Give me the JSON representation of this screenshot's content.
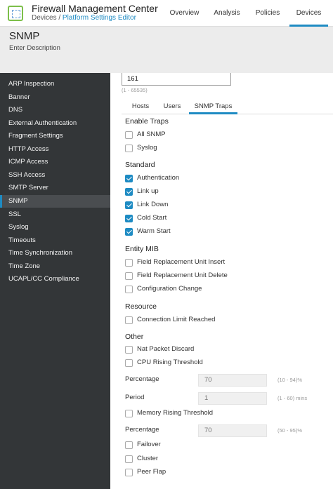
{
  "header": {
    "app_title": "Firewall Management Center",
    "breadcrumb_root": "Devices / ",
    "breadcrumb_link": "Platform Settings Editor",
    "nav": [
      "Overview",
      "Analysis",
      "Policies",
      "Devices"
    ],
    "active_nav": "Devices"
  },
  "page": {
    "title": "SNMP",
    "description": "Enter Description"
  },
  "sidebar": {
    "items": [
      "ARP Inspection",
      "Banner",
      "DNS",
      "External Authentication",
      "Fragment Settings",
      "HTTP Access",
      "ICMP Access",
      "SSH Access",
      "SMTP Server",
      "SNMP",
      "SSL",
      "Syslog",
      "Timeouts",
      "Time Synchronization",
      "Time Zone",
      "UCAPL/CC Compliance"
    ],
    "active": "SNMP"
  },
  "port": {
    "value": "161",
    "range_hint": "(1 - 65535)"
  },
  "tabs": {
    "items": [
      "Hosts",
      "Users",
      "SNMP Traps"
    ],
    "active": "SNMP Traps"
  },
  "traps": {
    "enable_traps": {
      "title": "Enable Traps",
      "all_snmp": "All SNMP",
      "syslog": "Syslog"
    },
    "standard": {
      "title": "Standard",
      "authentication": "Authentication",
      "link_up": "Link up",
      "link_down": "Link Down",
      "cold_start": "Cold Start",
      "warm_start": "Warm Start"
    },
    "entity_mib": {
      "title": "Entity MIB",
      "fru_insert": "Field Replacement Unit Insert",
      "fru_delete": "Field Replacement Unit Delete",
      "config_change": "Configuration Change"
    },
    "resource": {
      "title": "Resource",
      "conn_limit": "Connection Limit Reached"
    },
    "other": {
      "title": "Other",
      "nat_discard": "Nat Packet Discard",
      "cpu_rising": "CPU Rising Threshold",
      "cpu_percentage_label": "Percentage",
      "cpu_percentage_value": "70",
      "cpu_percentage_hint": "(10 - 94)%",
      "period_label": "Period",
      "period_value": "1",
      "period_hint": "(1 - 60) mins",
      "memory_rising": "Memory Rising Threshold",
      "mem_percentage_label": "Percentage",
      "mem_percentage_value": "70",
      "mem_percentage_hint": "(50 - 95)%",
      "failover": "Failover",
      "cluster": "Cluster",
      "peer_flap": "Peer Flap"
    },
    "checked": [
      "authentication",
      "link_up",
      "link_down",
      "cold_start",
      "warm_start"
    ]
  },
  "colors": {
    "accent": "#1e8bc3",
    "sidebar_bg": "#333638",
    "header_bg": "#ececec"
  },
  "icons": {
    "logo": "fmc-logo-icon"
  }
}
